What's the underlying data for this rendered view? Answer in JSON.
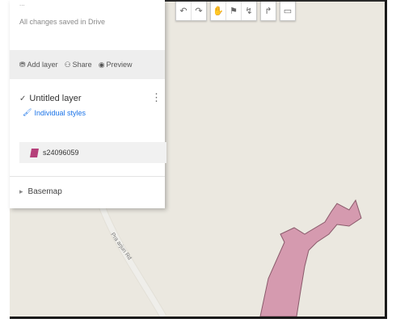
{
  "panel": {
    "top_label": "...",
    "saved_status": "All changes saved in Drive",
    "actions": [
      {
        "icon": "add-layer-icon",
        "label": "Add layer"
      },
      {
        "icon": "share-icon",
        "label": "Share"
      },
      {
        "icon": "preview-icon",
        "label": "Preview"
      }
    ],
    "layer": {
      "title": "Untitled layer",
      "style_link": "Individual styles",
      "features": [
        {
          "label": "s24096059",
          "color": "#b5407a"
        }
      ]
    },
    "basemap_label": "Basemap"
  },
  "map": {
    "road_label": "Pra arjun Rd",
    "polygon_color": "#d59aaf",
    "polygon_stroke": "#8a5a6b",
    "background": "#ebe8e0"
  },
  "toolbar": [
    {
      "name": "undo-icon",
      "glyph": "↶"
    },
    {
      "name": "redo-icon",
      "glyph": "↷"
    },
    {
      "name": "hand-icon",
      "glyph": "✋"
    },
    {
      "name": "marker-icon",
      "glyph": "⚑"
    },
    {
      "name": "draw-line-icon",
      "glyph": "↯"
    },
    {
      "name": "directions-icon",
      "glyph": "↱"
    },
    {
      "name": "ruler-icon",
      "glyph": "▭"
    }
  ]
}
